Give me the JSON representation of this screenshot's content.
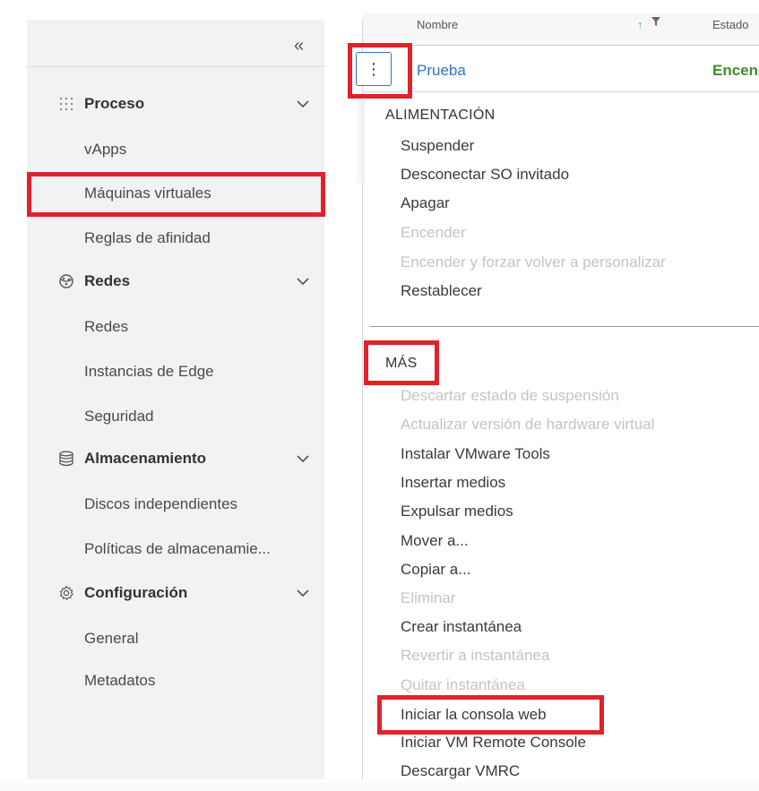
{
  "sidebar": {
    "collapse_glyph": "«",
    "groups": [
      {
        "label": "Proceso",
        "icon": "grid-dots-icon"
      },
      {
        "label": "Redes",
        "icon": "network-globe-icon"
      },
      {
        "label": "Almacenamiento",
        "icon": "database-icon"
      },
      {
        "label": "Configuración",
        "icon": "gear-icon"
      }
    ],
    "items": {
      "vapps": "vApps",
      "vms": "Máquinas virtuales",
      "affinity": "Reglas de afinidad",
      "networks": "Redes",
      "edges": "Instancias de Edge",
      "security": "Seguridad",
      "disks": "Discos independientes",
      "storage_policies": "Políticas de almacenamie...",
      "general": "General",
      "metadata": "Metadatos"
    }
  },
  "table": {
    "col_name": "Nombre",
    "col_status": "Estado",
    "row": {
      "name": "Prueba",
      "status": "Encendido"
    },
    "kebab_glyph": "⋮"
  },
  "menu": {
    "power_header": "ALIMENTACIÓN",
    "power_items": [
      {
        "label": "Suspender",
        "enabled": true
      },
      {
        "label": "Desconectar SO invitado",
        "enabled": true
      },
      {
        "label": "Apagar",
        "enabled": true
      },
      {
        "label": "Encender",
        "enabled": false
      },
      {
        "label": "Encender y forzar volver a personalizar",
        "enabled": false
      },
      {
        "label": "Restablecer",
        "enabled": true
      }
    ],
    "more_header": "MÁS",
    "more_items": [
      {
        "label": "Descartar estado de suspensión",
        "enabled": false
      },
      {
        "label": "Actualizar versión de hardware virtual",
        "enabled": false
      },
      {
        "label": "Instalar VMware Tools",
        "enabled": true
      },
      {
        "label": "Insertar medios",
        "enabled": true
      },
      {
        "label": "Expulsar medios",
        "enabled": true
      },
      {
        "label": "Mover a...",
        "enabled": true
      },
      {
        "label": "Copiar a...",
        "enabled": true
      },
      {
        "label": "Eliminar",
        "enabled": false
      },
      {
        "label": "Crear instantánea",
        "enabled": true
      },
      {
        "label": "Revertir a instantánea",
        "enabled": false
      },
      {
        "label": "Quitar instantánea",
        "enabled": false
      },
      {
        "label": "Iniciar la consola web",
        "enabled": true
      },
      {
        "label": "Iniciar VM Remote Console",
        "enabled": true
      },
      {
        "label": "Descargar VMRC",
        "enabled": true
      }
    ]
  },
  "colors": {
    "highlight": "#e0222b",
    "link": "#2e74c4",
    "status_on": "#3f8f2c",
    "disabled_text": "#c4c4c4"
  }
}
